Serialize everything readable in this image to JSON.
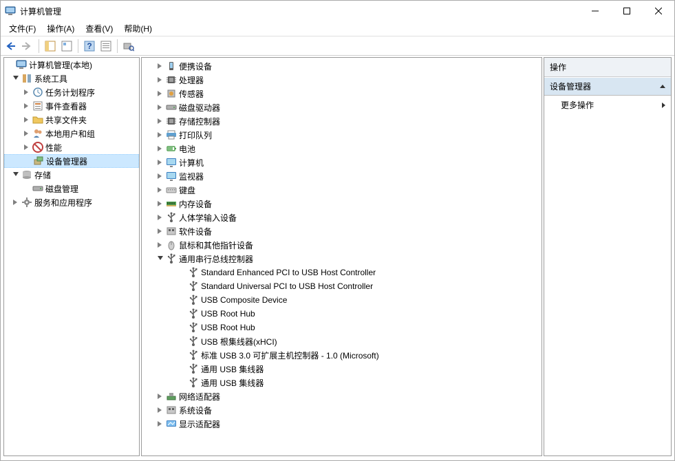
{
  "window": {
    "title": "计算机管理"
  },
  "menu": {
    "file": "文件(F)",
    "action": "操作(A)",
    "view": "查看(V)",
    "help": "帮助(H)"
  },
  "left_tree": {
    "root": "计算机管理(本地)",
    "system_tools": "系统工具",
    "task_scheduler": "任务计划程序",
    "event_viewer": "事件查看器",
    "shared_folders": "共享文件夹",
    "local_users": "本地用户和组",
    "performance": "性能",
    "device_manager": "设备管理器",
    "storage": "存储",
    "disk_mgmt": "磁盘管理",
    "services_apps": "服务和应用程序"
  },
  "devices": {
    "portable": "便携设备",
    "processors": "处理器",
    "sensors": "传感器",
    "disk_drives": "磁盘驱动器",
    "storage_ctrl": "存储控制器",
    "print_queues": "打印队列",
    "batteries": "电池",
    "computer": "计算机",
    "monitors": "监视器",
    "keyboards": "键盘",
    "memory": "内存设备",
    "hid": "人体学输入设备",
    "software_dev": "软件设备",
    "mice": "鼠标和其他指针设备",
    "usb_ctrl": "通用串行总线控制器",
    "usb_children": [
      "Standard Enhanced PCI to USB Host Controller",
      "Standard Universal PCI to USB Host Controller",
      "USB Composite Device",
      "USB Root Hub",
      "USB Root Hub",
      "USB 根集线器(xHCI)",
      "标准 USB 3.0 可扩展主机控制器 - 1.0 (Microsoft)",
      "通用 USB 集线器",
      "通用 USB 集线器"
    ],
    "network": "网络适配器",
    "system_dev": "系统设备",
    "display": "显示适配器"
  },
  "actions_pane": {
    "header": "操作",
    "section": "设备管理器",
    "more": "更多操作"
  },
  "icons": {
    "app": "computer-management-icon",
    "back": "back-arrow-icon",
    "forward": "forward-arrow-icon"
  }
}
